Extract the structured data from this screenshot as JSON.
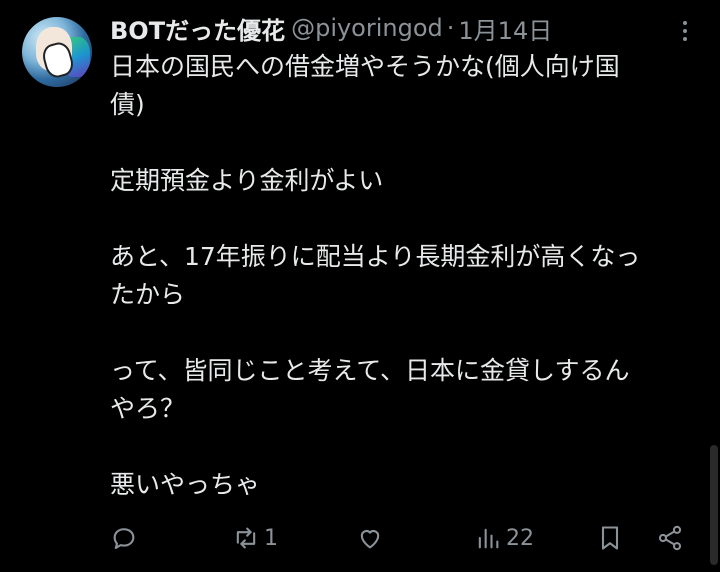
{
  "tweet": {
    "author_name": "BOTだった優花",
    "handle": "@piyoringod",
    "separator": "·",
    "date": "1月14日",
    "lines": [
      "日本の国民への借金増やそうかな(個人向け国",
      "債)",
      "",
      "定期預金より金利がよい",
      "",
      "あと、17年振りに配当より長期金利が高くなっ",
      "たから",
      "",
      "って、皆同じこと考えて、日本に金貸しするん",
      "やろ？",
      "",
      "悪いやっちゃ"
    ]
  },
  "actions": {
    "reply_icon": "reply-icon",
    "retweet_icon": "retweet-icon",
    "retweet_count": "1",
    "like_icon": "like-icon",
    "views_icon": "views-icon",
    "views_count": "22",
    "bookmark_icon": "bookmark-icon",
    "share_icon": "share-icon"
  },
  "colors": {
    "background": "#000000",
    "text": "#e7e9ea",
    "secondary": "#8b9298"
  }
}
